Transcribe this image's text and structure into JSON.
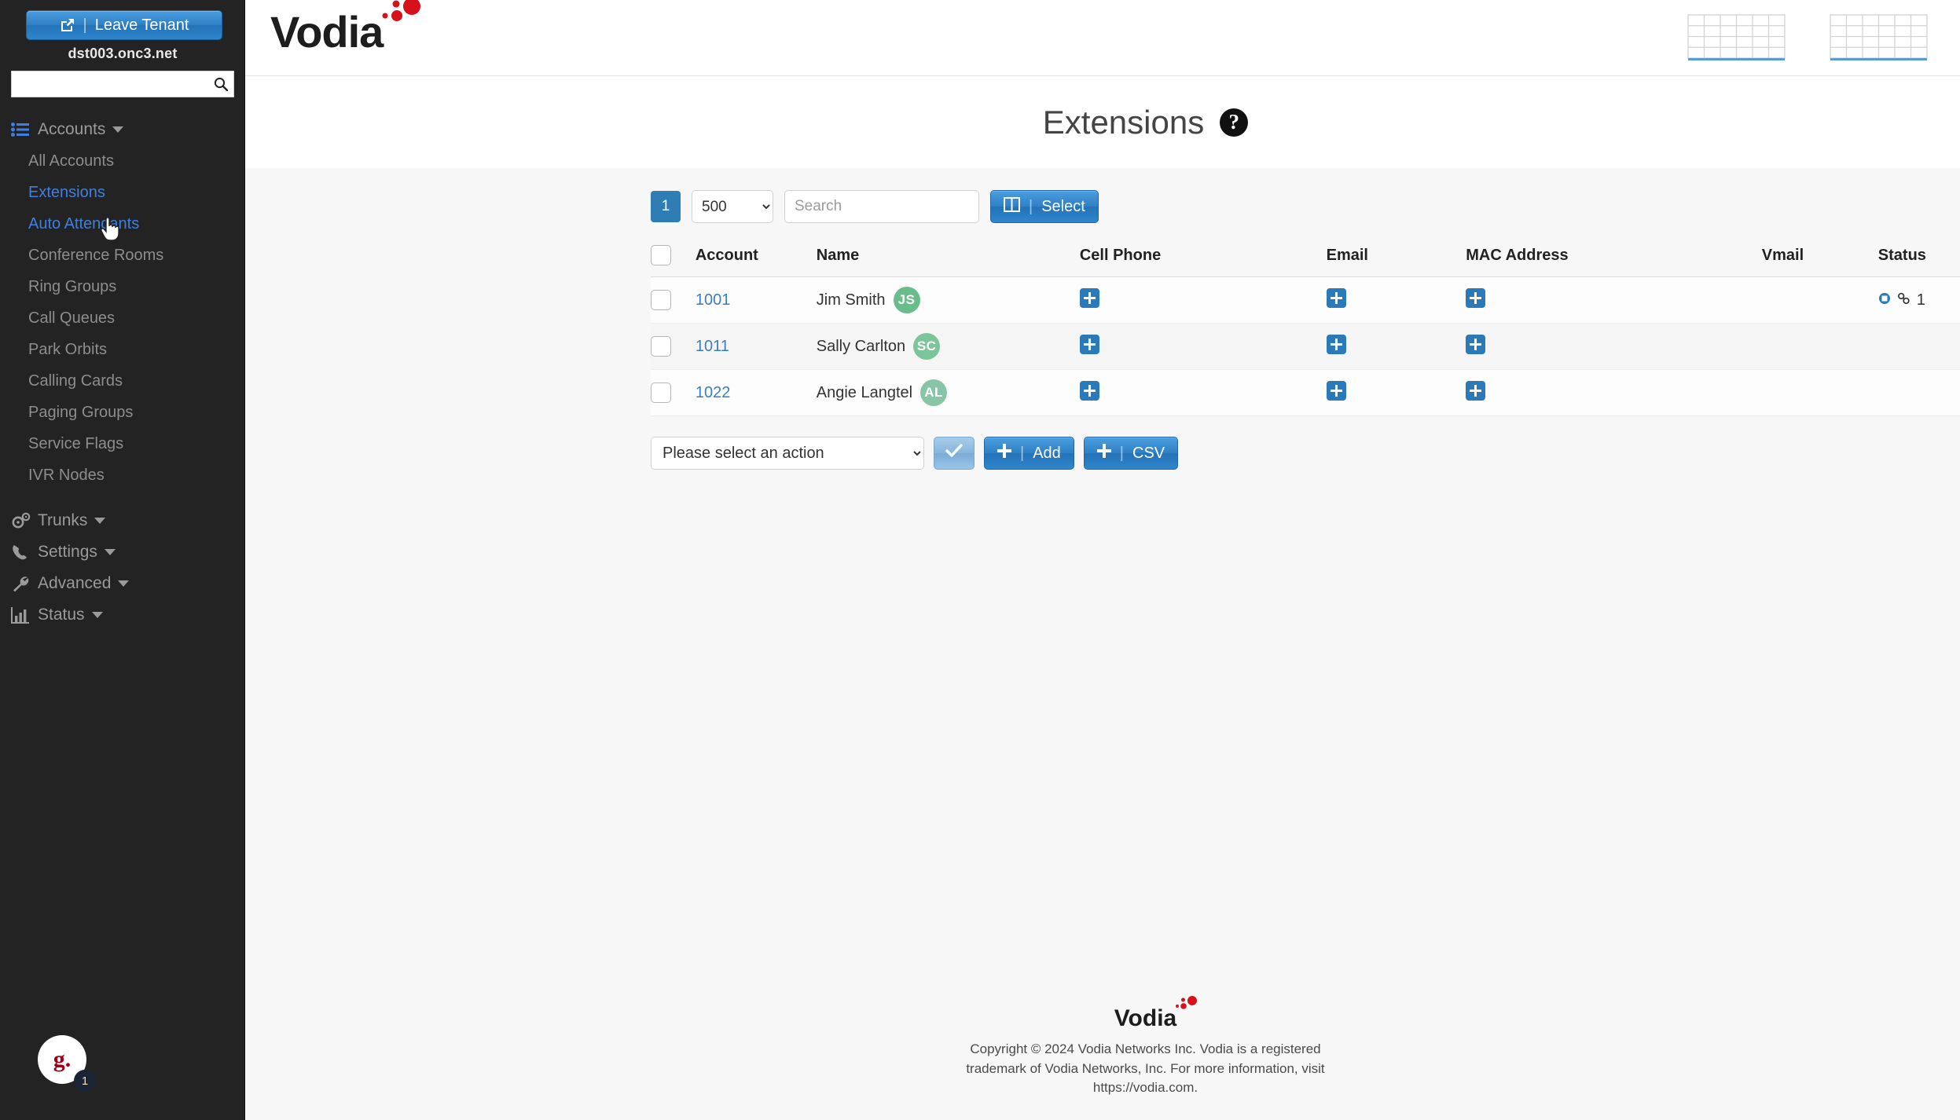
{
  "sidebar": {
    "leave_tenant_label": "Leave Tenant",
    "leave_tenant_icon": "external-link-icon",
    "tenant_name": "dst003.onc3.net",
    "search_placeholder": "",
    "search_value": "",
    "search_icon": "search-icon",
    "accounts_group": {
      "label": "Accounts",
      "icon": "list-icon",
      "items": [
        {
          "label": "All Accounts",
          "state": "normal"
        },
        {
          "label": "Extensions",
          "state": "active"
        },
        {
          "label": "Auto Attendants",
          "state": "hover"
        },
        {
          "label": "Conference Rooms",
          "state": "normal"
        },
        {
          "label": "Ring Groups",
          "state": "normal"
        },
        {
          "label": "Call Queues",
          "state": "normal"
        },
        {
          "label": "Park Orbits",
          "state": "normal"
        },
        {
          "label": "Calling Cards",
          "state": "normal"
        },
        {
          "label": "Paging Groups",
          "state": "normal"
        },
        {
          "label": "Service Flags",
          "state": "normal"
        },
        {
          "label": "IVR Nodes",
          "state": "normal"
        }
      ]
    },
    "sections": [
      {
        "label": "Trunks",
        "icon": "gears-icon"
      },
      {
        "label": "Settings",
        "icon": "phone-icon"
      },
      {
        "label": "Advanced",
        "icon": "wrench-icon"
      },
      {
        "label": "Status",
        "icon": "bar-chart-icon"
      }
    ],
    "avatar": {
      "initial": "g.",
      "badge": "1"
    }
  },
  "header": {
    "logo_text": "Vodia",
    "icons": [
      "table-grid-icon",
      "table-grid-icon",
      "logout-icon"
    ]
  },
  "page": {
    "title": "Extensions",
    "help_icon": "question-mark-icon"
  },
  "toolbar": {
    "page_number": "1",
    "per_page_selected": "500",
    "per_page_options": [
      "500"
    ],
    "search_placeholder": "Search",
    "search_value": "",
    "select_label": "Select",
    "select_icon": "columns-icon"
  },
  "table": {
    "columns": [
      "Account",
      "Name",
      "Cell Phone",
      "Email",
      "MAC Address",
      "Vmail",
      "Status"
    ],
    "rows": [
      {
        "account": "1001",
        "name": "Jim Smith",
        "initials": "JS",
        "avatar_color": "#69bd8b",
        "cell_phone": "add-icon",
        "email": "add-icon",
        "mac_address": "add-icon",
        "vmail": "",
        "status_count": "1",
        "status_icons": [
          "registration-dot-icon",
          "chain-link-icon"
        ]
      },
      {
        "account": "1011",
        "name": "Sally Carlton",
        "initials": "SC",
        "avatar_color": "#7cc49a",
        "cell_phone": "add-icon",
        "email": "add-icon",
        "mac_address": "add-icon",
        "vmail": "",
        "status_count": "",
        "status_icons": []
      },
      {
        "account": "1022",
        "name": "Angie Langtel",
        "initials": "AL",
        "avatar_color": "#88c4a8",
        "cell_phone": "add-icon",
        "email": "add-icon",
        "mac_address": "add-icon",
        "vmail": "",
        "status_count": "",
        "status_icons": []
      }
    ]
  },
  "actions": {
    "select_action_value": "Please select an action",
    "select_action_options": [
      "Please select an action"
    ],
    "apply_icon": "check-icon",
    "add_label": "Add",
    "csv_label": "CSV",
    "plus_icon": "plus-icon"
  },
  "footer": {
    "logo_text": "Vodia",
    "line1": "Copyright © 2024 Vodia Networks Inc. Vodia is a registered",
    "line2": "trademark of Vodia Networks, Inc. For more information, visit",
    "line3": "https://vodia.com."
  },
  "colors": {
    "accent_blue": "#2f7fc4",
    "sidebar_bg": "#232323",
    "link_blue": "#3a7fbf",
    "logo_red": "#d7101a",
    "active_nav": "#3e7fe0"
  }
}
